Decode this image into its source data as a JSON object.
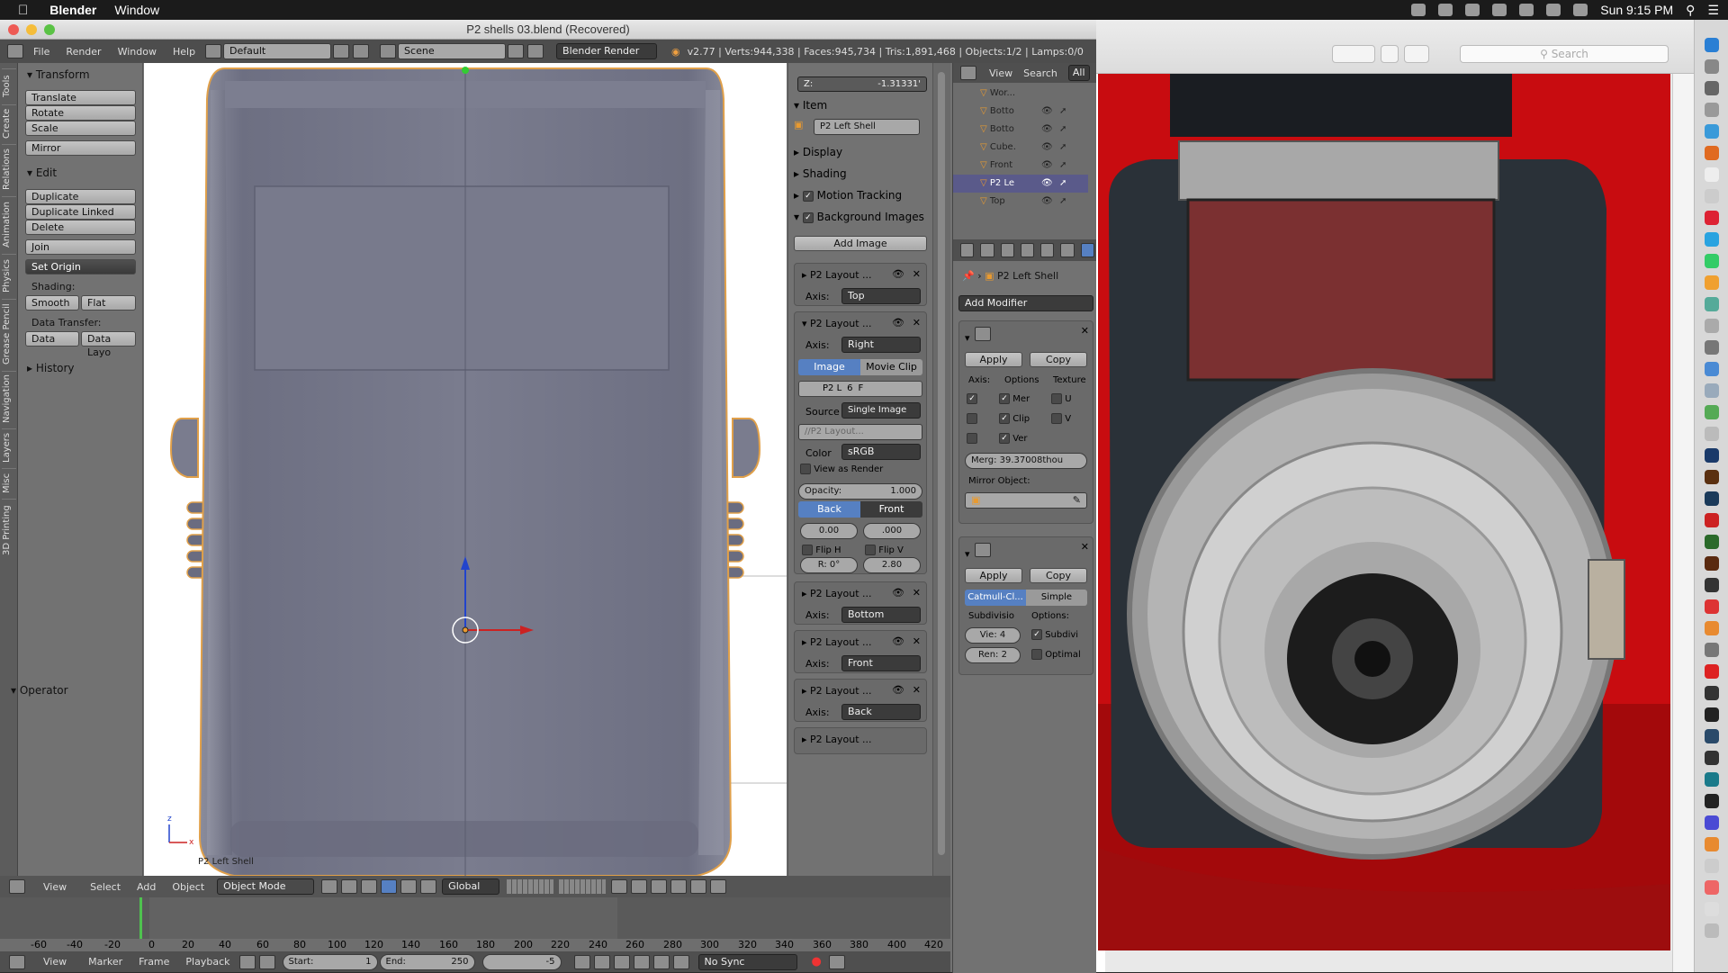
{
  "menubar": {
    "apple": "",
    "app": "Blender",
    "items": [
      "Window"
    ],
    "clock": "Sun 9:15 PM"
  },
  "window": {
    "title": "P2 shells 03.blend (Recovered)"
  },
  "infobar": {
    "menus": [
      "File",
      "Render",
      "Window",
      "Help"
    ],
    "layout": "Default",
    "scene": "Scene",
    "engine": "Blender Render",
    "stats": "v2.77 | Verts:944,338 | Faces:945,734 | Tris:1,891,468 | Objects:1/2 | Lamps:0/0"
  },
  "toolshelf": {
    "tabs": [
      "Tools",
      "Create",
      "Relations",
      "Animation",
      "Physics",
      "Grease Pencil",
      "Navigation",
      "Layers",
      "Misc",
      "3D Printing"
    ],
    "transform_title": "Transform",
    "transform_buttons": [
      "Translate",
      "Rotate",
      "Scale",
      "Mirror"
    ],
    "edit_title": "Edit",
    "edit_buttons": [
      "Duplicate",
      "Duplicate Linked",
      "Delete",
      "Join"
    ],
    "set_origin": "Set Origin",
    "shading_label": "Shading:",
    "smooth": "Smooth",
    "flat": "Flat",
    "data_transfer_label": "Data Transfer:",
    "data": "Data",
    "data_layout": "Data Layo",
    "history_title": "History",
    "operator_title": "Operator"
  },
  "viewport": {
    "object_label": "P2 Left Shell",
    "axis_z": "z",
    "axis_x": "x"
  },
  "npanel": {
    "z_label": "Z:",
    "z_value": "-1.31331'",
    "item_title": "Item",
    "item_name": "P2 Left Shell",
    "display_title": "Display",
    "shading_title": "Shading",
    "motion_tracking": "Motion Tracking",
    "background_images": "Background Images",
    "add_image": "Add Image",
    "layouts": [
      {
        "name": "P2 Layout ...",
        "axis": "Top"
      },
      {
        "name": "P2 Layout ...",
        "axis": "Right"
      },
      {
        "name": "P2 Layout ...",
        "axis": "Bottom"
      },
      {
        "name": "P2 Layout ...",
        "axis": "Front"
      },
      {
        "name": "P2 Layout ...",
        "axis": "Back"
      }
    ],
    "axis_label": "Axis:",
    "image_tab": "Image",
    "movieclip_tab": "Movie Clip",
    "p2l": "P2 L",
    "six": "6",
    "f": "F",
    "source_label": "Source",
    "source_value": "Single Image",
    "path": "//P2 Layout...",
    "color_label": "Color",
    "color_value": "sRGB",
    "view_as_render": "View as Render",
    "opacity": "Opacity:",
    "opacity_value": "1.000",
    "back": "Back",
    "front": "Front",
    "x_off": "0.00",
    "y_off": ".000",
    "flip_h": "Flip H",
    "flip_v": "Flip V",
    "rot": "R: 0°",
    "size": "2.80",
    "last_layout": "P2 Layout ..."
  },
  "outliner": {
    "menus": [
      "View",
      "Search",
      "All"
    ],
    "items": [
      "Wor...",
      "Botto",
      "Botto",
      "Cube.",
      "Front",
      "P2 Le",
      "Top"
    ]
  },
  "props": {
    "object_name": "P2 Left Shell",
    "add_modifier": "Add Modifier",
    "apply": "Apply",
    "copy": "Copy",
    "axis_label": "Axis:",
    "options_label": "Options",
    "texture_label": "Texture",
    "mer": "Mer",
    "clip": "Clip",
    "ver": "Ver",
    "u": "U",
    "v": "V",
    "merge": "Merg: 39.37008thou",
    "mirror_object": "Mirror Object:",
    "catmull": "Catmull-Cl...",
    "simple": "Simple",
    "subdiv_label": "Subdivisio",
    "options2": "Options:",
    "view_levels": "Vie: 4",
    "render_levels": "Ren: 2",
    "subdivi": "Subdivi",
    "optimal": "Optimal"
  },
  "viewheader": {
    "menus": [
      "View",
      "Select",
      "Add",
      "Object"
    ],
    "mode": "Object Mode",
    "orientation": "Global"
  },
  "timeline": {
    "ticks": [
      "-60",
      "-40",
      "-20",
      "0",
      "20",
      "40",
      "60",
      "80",
      "100",
      "120",
      "140",
      "160",
      "180",
      "200",
      "220",
      "240",
      "260",
      "280",
      "300",
      "320",
      "340",
      "360",
      "380",
      "400",
      "420"
    ],
    "current_frame": 0,
    "menus": [
      "View",
      "Marker",
      "Frame",
      "Playback"
    ],
    "start": "Start:",
    "start_val": "1",
    "end": "End:",
    "end_val": "250",
    "frame_val": "-5",
    "sync": "No Sync"
  },
  "preview": {
    "search_placeholder": "Search"
  },
  "colors": {
    "blender_bg": "#727272",
    "accent_blue": "#5680c2",
    "photo_red": "#c80c10"
  }
}
